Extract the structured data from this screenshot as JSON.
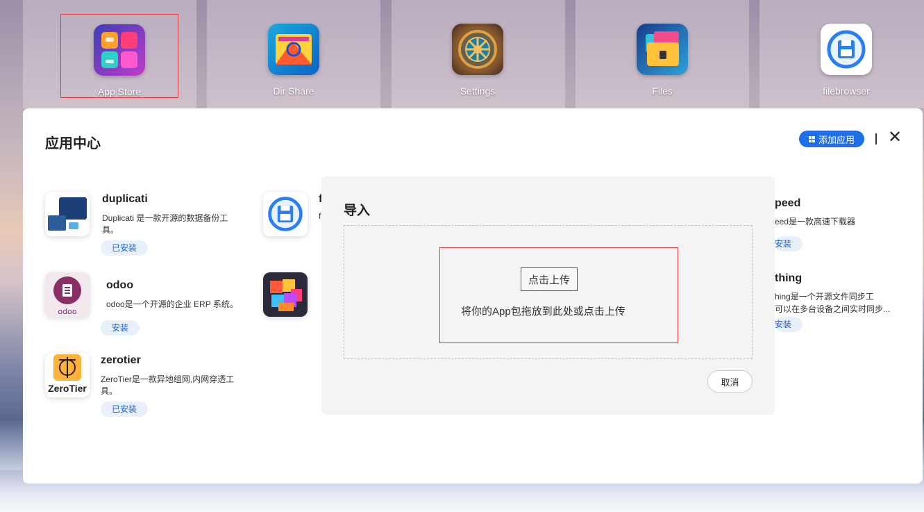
{
  "desktop": {
    "icons": [
      {
        "label": "App Store"
      },
      {
        "label": "Dir Share"
      },
      {
        "label": "Settings"
      },
      {
        "label": "Files"
      },
      {
        "label": "filebrowser"
      }
    ]
  },
  "app_center": {
    "title": "应用中心",
    "add_button_label": "添加应用",
    "close_icon": "close-icon",
    "apps": [
      {
        "name": "duplicati",
        "desc": "Duplicati 是一款开源的数据备份工具。",
        "badge": "已安装"
      },
      {
        "name": "odoo",
        "desc": "odoo是一个开源的企业 ERP 系统。",
        "badge": "安装"
      },
      {
        "name": "zerotier",
        "desc": "ZeroTier是一款异地组网,内网穿透工具。",
        "badge": "已安装"
      }
    ],
    "partial_apps": [
      {
        "name": "f",
        "desc": "f"
      },
      {
        "name": "peed",
        "desc": "eed是一款高速下载器",
        "badge": "安装"
      },
      {
        "name": "thing",
        "desc_line1": "hing是一个开源文件同步工",
        "desc_line2": "可以在多台设备之间实时同步...",
        "badge": "安装"
      }
    ]
  },
  "import_dialog": {
    "title": "导入",
    "upload_button": "点击上传",
    "hint": "将你的App包拖放到此处或点击上传",
    "cancel_button": "取消"
  },
  "colors": {
    "accent": "#1f6fe6",
    "badge_bg": "#e8f0fc",
    "selection": "#e23b3b"
  }
}
